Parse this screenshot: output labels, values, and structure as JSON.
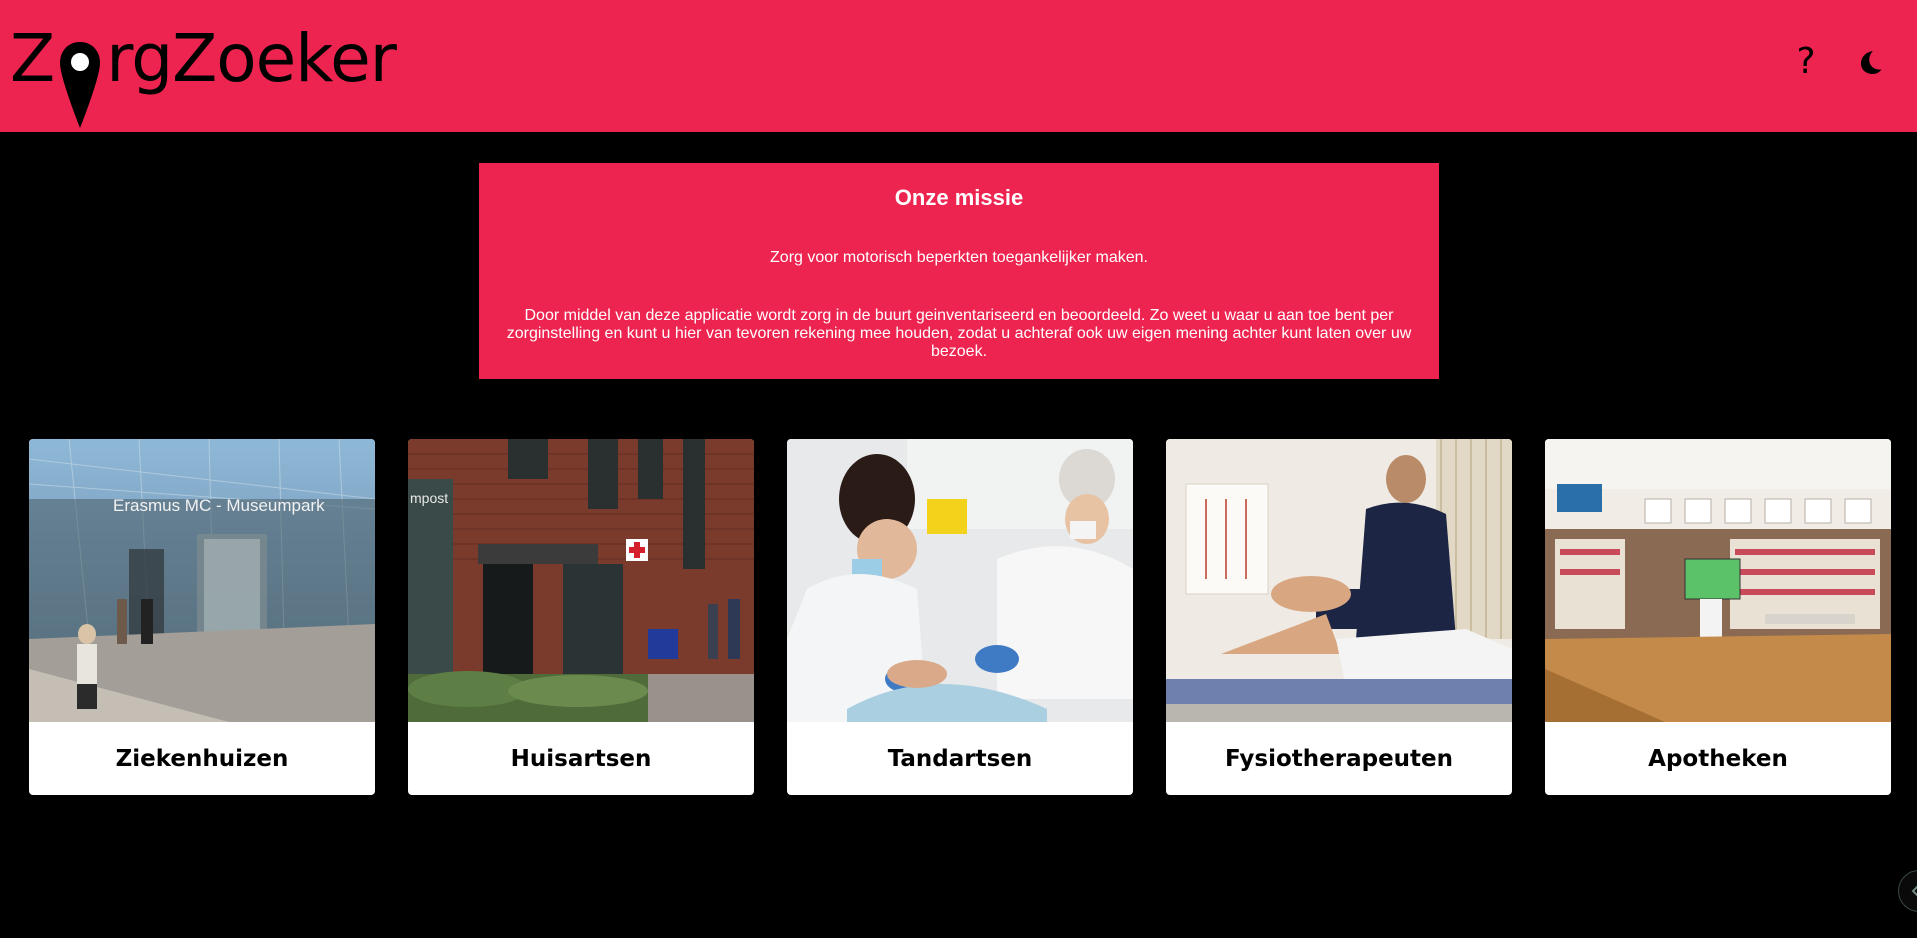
{
  "header": {
    "logo": {
      "first_letter": "Z",
      "rest": "rgZoeker",
      "alt": "ZorgZoeker"
    },
    "help_icon": "question-mark",
    "theme_icon": "moon"
  },
  "mission": {
    "title": "Onze missie",
    "subtitle": "Zorg voor motorisch beperkten toegankelijker maken.",
    "description": "Door middel van deze applicatie wordt zorg in de buurt geinventariseerd en beoordeeld. Zo weet u waar u aan toe bent per zorginstelling en kunt u hier van tevoren rekening mee houden, zodat u achteraf ook uw eigen mening achter kunt laten over uw bezoek."
  },
  "categories": [
    {
      "label": "Ziekenhuizen",
      "image": "hospital-entrance-photo",
      "sign_text": "Erasmus MC - Museumpark"
    },
    {
      "label": "Huisartsen",
      "image": "gp-practice-photo",
      "sign_text": "mpost"
    },
    {
      "label": "Tandartsen",
      "image": "dentist-treatment-photo"
    },
    {
      "label": "Fysiotherapeuten",
      "image": "physiotherapy-photo"
    },
    {
      "label": "Apotheken",
      "image": "pharmacy-interior-photo"
    }
  ],
  "colors": {
    "brand": "#ee2450",
    "background": "#000000",
    "card": "#ffffff"
  }
}
